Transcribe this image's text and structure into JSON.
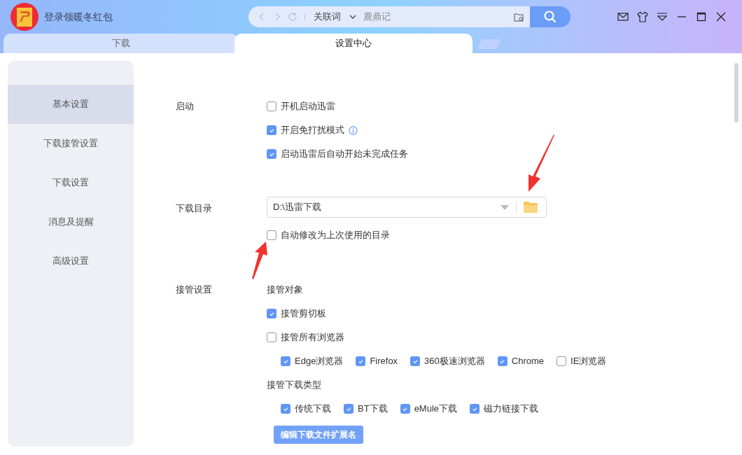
{
  "header": {
    "promo": "登录领暖冬红包",
    "search": {
      "mode": "关联词",
      "placeholder": "鹿鼎记"
    }
  },
  "tabs": [
    {
      "label": "下载",
      "selected": false
    },
    {
      "label": "设置中心",
      "selected": true
    }
  ],
  "sidebar": {
    "items": [
      {
        "label": "基本设置",
        "selected": true
      },
      {
        "label": "下载接管设置",
        "selected": false
      },
      {
        "label": "下载设置",
        "selected": false
      },
      {
        "label": "消息及提醒",
        "selected": false
      },
      {
        "label": "高级设置",
        "selected": false
      }
    ]
  },
  "sections": [
    {
      "label": "启动",
      "rows": [
        {
          "kind": "checkbox",
          "label": "开机启动迅雷",
          "checked": false
        },
        {
          "kind": "checkbox",
          "label": "开启免打扰模式",
          "checked": true,
          "info": true
        },
        {
          "kind": "checkbox",
          "label": "启动迅雷后自动开始未完成任务",
          "checked": true
        }
      ]
    },
    {
      "label": "下载目录",
      "rows": [
        {
          "kind": "folder",
          "value": "D:\\迅雷下载"
        },
        {
          "kind": "checkbox",
          "label": "自动修改为上次使用的目录",
          "checked": false
        }
      ]
    },
    {
      "label": "接管设置",
      "rows": [
        {
          "kind": "subheading",
          "label": "接管对象"
        },
        {
          "kind": "checkbox",
          "label": "接管剪切板",
          "checked": true
        },
        {
          "kind": "checkbox",
          "label": "接管所有浏览器",
          "checked": false
        },
        {
          "kind": "group",
          "items": [
            {
              "label": "Edge浏览器",
              "checked": true
            },
            {
              "label": "Firefox",
              "checked": true
            },
            {
              "label": "360极速浏览器",
              "checked": true
            },
            {
              "label": "Chrome",
              "checked": true
            },
            {
              "label": "IE浏览器",
              "checked": false
            }
          ]
        },
        {
          "kind": "subheading",
          "label": "接管下载类型"
        },
        {
          "kind": "group",
          "items": [
            {
              "label": "传统下载",
              "checked": true
            },
            {
              "label": "BT下载",
              "checked": true
            },
            {
              "label": "eMule下载",
              "checked": true
            },
            {
              "label": "磁力链接下载",
              "checked": true
            }
          ]
        },
        {
          "kind": "button",
          "label": "编辑下载文件扩展名"
        }
      ]
    }
  ]
}
